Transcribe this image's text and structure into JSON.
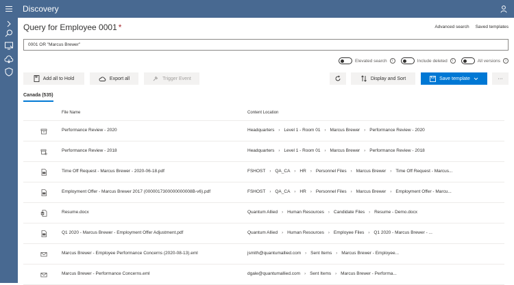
{
  "app": {
    "title": "Discovery"
  },
  "nav": {
    "icons": [
      "chevron-right-icon",
      "search-icon",
      "device-icon",
      "cloud-icon",
      "shield-icon"
    ]
  },
  "header": {
    "title": "Query for Employee 0001",
    "required_marker": "*",
    "links": {
      "advanced_search": "Advanced search",
      "saved_templates": "Saved templates"
    }
  },
  "query": {
    "value": "0001 OR \"Marcus Brewer\""
  },
  "toggles": {
    "elevated_search": "Elevated search",
    "include_deleted": "Include deleted",
    "all_versions": "All versions"
  },
  "toolbar": {
    "add_all_to_hold": "Add all to Hold",
    "export_all": "Export all",
    "trigger_event": "Trigger Event",
    "display_and_sort": "Display and Sort",
    "save_template": "Save template",
    "more": "···"
  },
  "tab": {
    "label": "Canada (535)"
  },
  "table": {
    "columns": {
      "file_name": "File Name",
      "content_location": "Content Location"
    },
    "rows": [
      {
        "icon": "archive-icon",
        "file_name": "Performance Review - 2020",
        "location": [
          "Headquarters",
          "Level 1 - Room 01",
          "Marcus Brewer",
          "Performance Review - 2020"
        ]
      },
      {
        "icon": "archive-search-icon",
        "file_name": "Performance Review - 2018",
        "location": [
          "Headquarters",
          "Level 1 - Room 01",
          "Marcus Brewer",
          "Performance Review - 2018"
        ]
      },
      {
        "icon": "pdf-file-icon",
        "file_name": "Time Off Request - Marcus Brewer - 2020-06-18.pdf",
        "location": [
          "FSHOST",
          "QA_CA",
          "HR",
          "Personnel Files",
          "Marcus Brewer",
          "Time Off Request - Marcus..."
        ]
      },
      {
        "icon": "pdf-file-icon",
        "file_name": "Employment Offer - Marcus Brewer 2017 (0000017300000000008B-v6).pdf",
        "location": [
          "FSHOST",
          "QA_CA",
          "HR",
          "Personnel Files",
          "Marcus Brewer",
          "Employment Offer - Marcu..."
        ]
      },
      {
        "icon": "word-file-icon",
        "file_name": "Resume.docx",
        "location": [
          "Quantum Allied",
          "Human Resources",
          "Candidate Files",
          "Resume - Demo.docx"
        ]
      },
      {
        "icon": "pdf-file-icon",
        "file_name": "Q1 2020 - Marcus Brewer - Employment Offer Adjustment.pdf",
        "location": [
          "Quantum Allied",
          "Human Resources",
          "Employee Files",
          "Q1 2020 - Marcus Brewer - ..."
        ]
      },
      {
        "icon": "email-icon",
        "file_name": "Marcus Brewer - Employee Performance Concerns (2020-08-13).eml",
        "location": [
          "jsmith@quantumallied.com",
          "Sent Items",
          "Marcus Brewer - Employee..."
        ]
      },
      {
        "icon": "email-icon",
        "file_name": "Marcus Brewer - Performance Concerns.eml",
        "location": [
          "dgale@quantumallied.com",
          "Sent Items",
          "Marcus Brewer - Performa..."
        ]
      }
    ]
  }
}
